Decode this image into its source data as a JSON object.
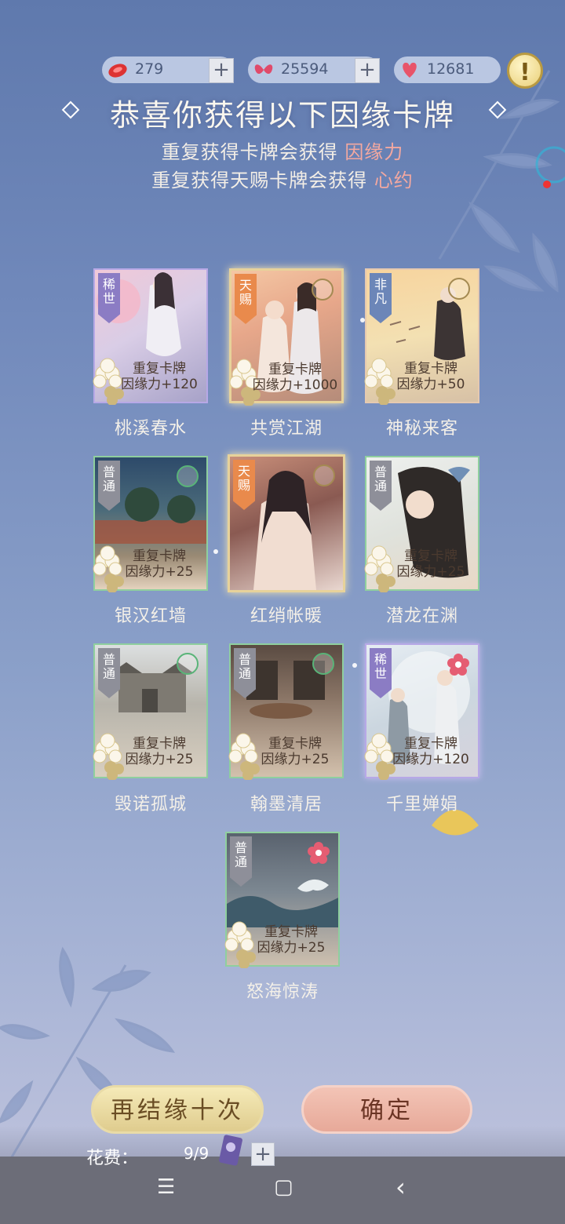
{
  "currency": {
    "gem": {
      "value": "279",
      "icon": "red-gem-icon"
    },
    "butterfly": {
      "value": "25594",
      "icon": "butterfly-icon"
    },
    "heart": {
      "value": "12681",
      "icon": "heart-icon"
    },
    "plus": "+",
    "alert": "!"
  },
  "header": {
    "title": "恭喜你获得以下因缘卡牌",
    "sub1_prefix": "重复获得卡牌会获得",
    "sub1_highlight": "因缘力",
    "sub2_prefix": "重复获得天赐卡牌会获得",
    "sub2_highlight": "心约"
  },
  "cards": [
    {
      "rank": "稀世",
      "repeat": "重复卡牌",
      "gain": "因缘力+120",
      "name": "桃溪春水"
    },
    {
      "rank": "天赐",
      "repeat": "重复卡牌",
      "gain": "因缘力+1000",
      "name": "共赏江湖"
    },
    {
      "rank": "非凡",
      "repeat": "重复卡牌",
      "gain": "因缘力+50",
      "name": "神秘来客"
    },
    {
      "rank": "普通",
      "repeat": "重复卡牌",
      "gain": "因缘力+25",
      "name": "银汉红墙"
    },
    {
      "rank": "天赐",
      "repeat": "",
      "gain": "",
      "name": "红绡帐暖"
    },
    {
      "rank": "普通",
      "repeat": "重复卡牌",
      "gain": "因缘力+25",
      "name": "潜龙在渊"
    },
    {
      "rank": "普通",
      "repeat": "重复卡牌",
      "gain": "因缘力+25",
      "name": "毁诺孤城"
    },
    {
      "rank": "普通",
      "repeat": "重复卡牌",
      "gain": "因缘力+25",
      "name": "翰墨清居"
    },
    {
      "rank": "稀世",
      "repeat": "重复卡牌",
      "gain": "因缘力+120",
      "name": "千里婵娟"
    },
    {
      "rank": "普通",
      "repeat": "重复卡牌",
      "gain": "因缘力+25",
      "name": "怒海惊涛"
    }
  ],
  "buttons": {
    "again": "再结缘十次",
    "confirm": "确定"
  },
  "cost": {
    "label": "花费：",
    "value": "9/9",
    "plus": "+"
  },
  "nav": {
    "menu": "☰",
    "home": "▢",
    "back": "‹"
  },
  "colors": {
    "highlight": "#f3a8a0",
    "rare_purple": "#8b7cc4",
    "common_gray": "#8e8f99",
    "divine_orange": "#e98a4c",
    "unusual_blue": "#6c86b8"
  }
}
